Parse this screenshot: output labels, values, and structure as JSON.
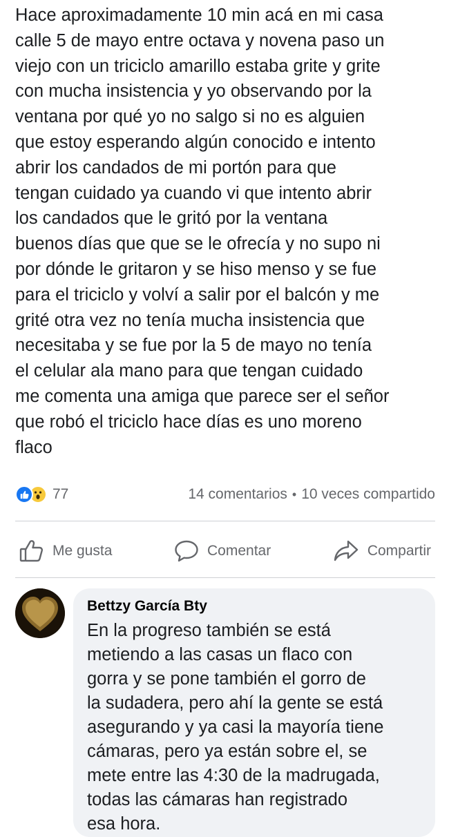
{
  "post": {
    "lines": [
      "Hace aproximadamente 10 min acá en mi casa",
      "calle 5 de mayo entre octava y novena paso un",
      "viejo con un triciclo amarillo estaba grite y grite",
      "con mucha insistencia y yo observando por la",
      "ventana por qué yo no salgo si no es alguien",
      "que estoy esperando algún conocido e intento",
      "abrir los candados de mi portón para que",
      "tengan cuidado ya cuando vi que intento abrir",
      "los candados que le gritó por la ventana",
      "buenos días que que se le ofrecía y no supo ni",
      "por dónde le gritaron y se hiso menso y se fue",
      "para el triciclo y volví a salir por el balcón y me",
      "grité otra vez no tenía mucha insistencia que",
      "necesitaba y se fue por la 5 de mayo no tenía",
      "el celular ala mano para que tengan cuidado",
      "me comenta una amiga que parece ser el señor",
      "que robó el triciclo hace días es uno moreno",
      "flaco"
    ]
  },
  "stats": {
    "reaction_count": "77",
    "comments": "14 comentarios",
    "separator": "•",
    "shares": "10 veces compartido"
  },
  "actions": {
    "like": "Me gusta",
    "comment": "Comentar",
    "share": "Compartir"
  },
  "comment": {
    "author": "Bettzy García Bty",
    "lines": [
      "En la progreso también se está",
      "metiendo a las casas un flaco con",
      "gorra y se pone también el gorro de",
      "la sudadera, pero ahí la gente se está",
      "asegurando y ya casi la mayoría tiene",
      "cámaras, pero ya están sobre el, se",
      "mete entre las 4:30 de la madrugada,",
      "todas las cámaras han registrado",
      "esa hora."
    ]
  },
  "colors": {
    "like_blue": "#1877f2",
    "wow_yellow": "#f7c93b",
    "muted_text": "#65676b",
    "bubble_bg": "#f0f2f5"
  },
  "icons": {
    "like_reaction": "thumbs-up-icon",
    "wow_reaction": "wow-face-icon",
    "like_action": "thumbs-up-outline-icon",
    "comment_action": "speech-bubble-icon",
    "share_action": "share-arrow-icon"
  }
}
